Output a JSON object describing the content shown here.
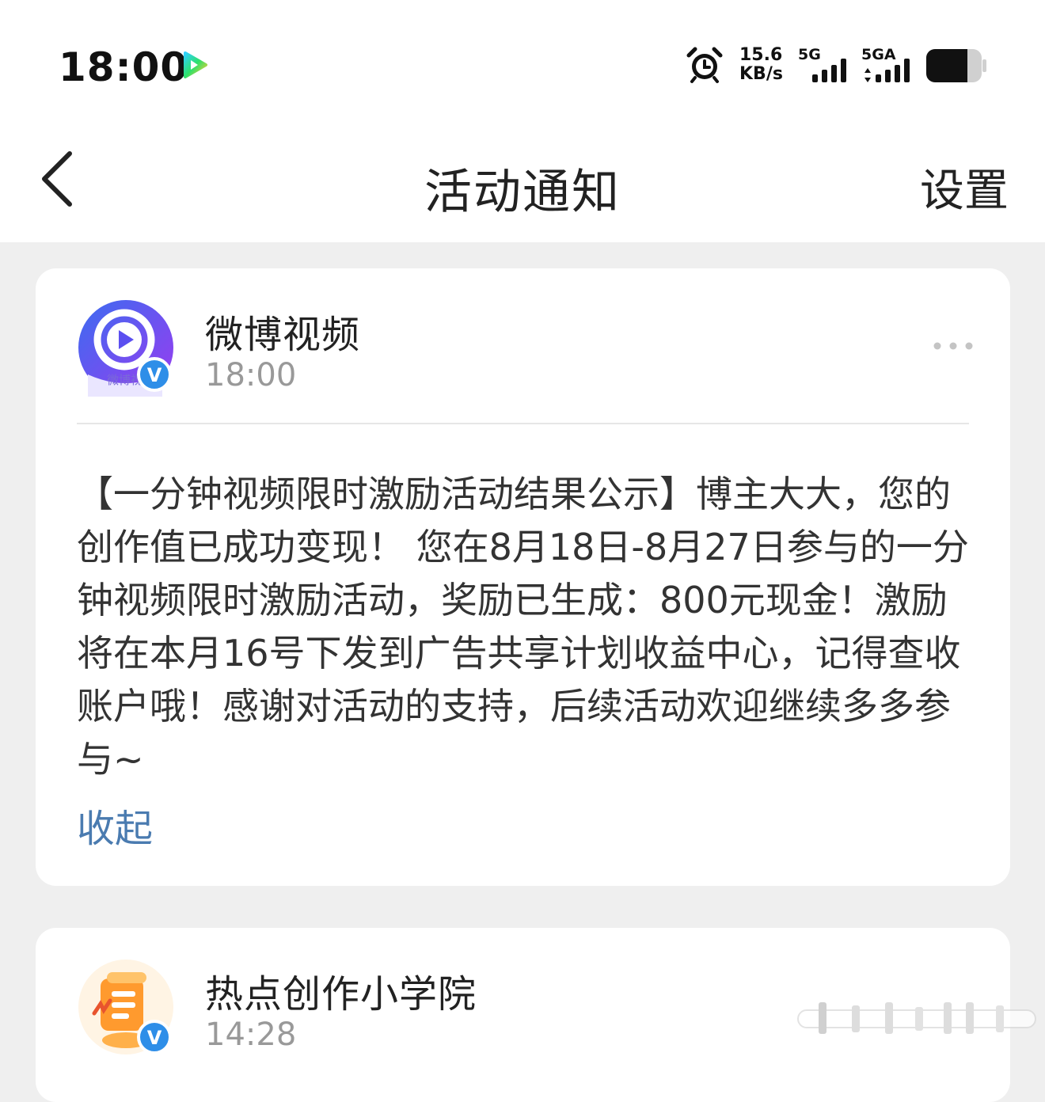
{
  "status_bar": {
    "time": "18:00",
    "app_icon": "video-play-icon",
    "alarm_icon": "alarm-clock-icon",
    "speed_value": "15.6",
    "speed_unit": "KB/s",
    "network1": "5G",
    "network2": "5GA",
    "battery_icon": "battery-icon"
  },
  "header": {
    "back_icon": "chevron-left-icon",
    "title": "活动通知",
    "settings_label": "设置"
  },
  "notifications": [
    {
      "sender": "微博视频",
      "time": "18:00",
      "avatar_text": "微博视",
      "verified_badge": "V",
      "body": "【一分钟视频限时激励活动结果公示】博主大大，您的创作值已成功变现！ 您在8月18日-8月27日参与的一分钟视频限时激励活动，奖励已生成：800元现金！激励将在本月16号下发到广告共享计划收益中心，记得查收账户哦！感谢对活动的支持，后续活动欢迎继续多多参与~",
      "collapse_label": "收起",
      "more_icon": "more-dots-icon"
    },
    {
      "sender": "热点创作小学院",
      "time": "14:28",
      "verified_badge": "V"
    }
  ],
  "colors": {
    "background": "#efefef",
    "card": "#ffffff",
    "link": "#4a7bb0",
    "muted": "#999999",
    "verified": "#2e8ee8"
  }
}
